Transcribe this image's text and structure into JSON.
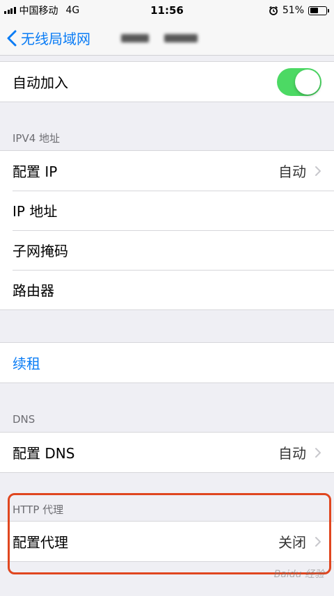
{
  "status_bar": {
    "carrier": "中国移动",
    "network": "4G",
    "time": "11:56",
    "battery": "51%",
    "battery_level": 0.51
  },
  "nav": {
    "back_label": "无线局域网"
  },
  "rows": {
    "auto_join": "自动加入",
    "auto_join_on": true,
    "configure_ip": "配置 IP",
    "configure_ip_value": "自动",
    "ip_address": "IP 地址",
    "subnet_mask": "子网掩码",
    "router": "路由器",
    "renew_lease": "续租",
    "configure_dns": "配置 DNS",
    "configure_dns_value": "自动",
    "configure_proxy": "配置代理",
    "configure_proxy_value": "关闭"
  },
  "sections": {
    "ipv4": "IPV4 地址",
    "dns": "DNS",
    "http_proxy": "HTTP 代理"
  },
  "colors": {
    "accent": "#0a7cf5",
    "toggle_on": "#4cd964",
    "highlight": "#e0461f"
  },
  "watermark": "Baidu 经验"
}
